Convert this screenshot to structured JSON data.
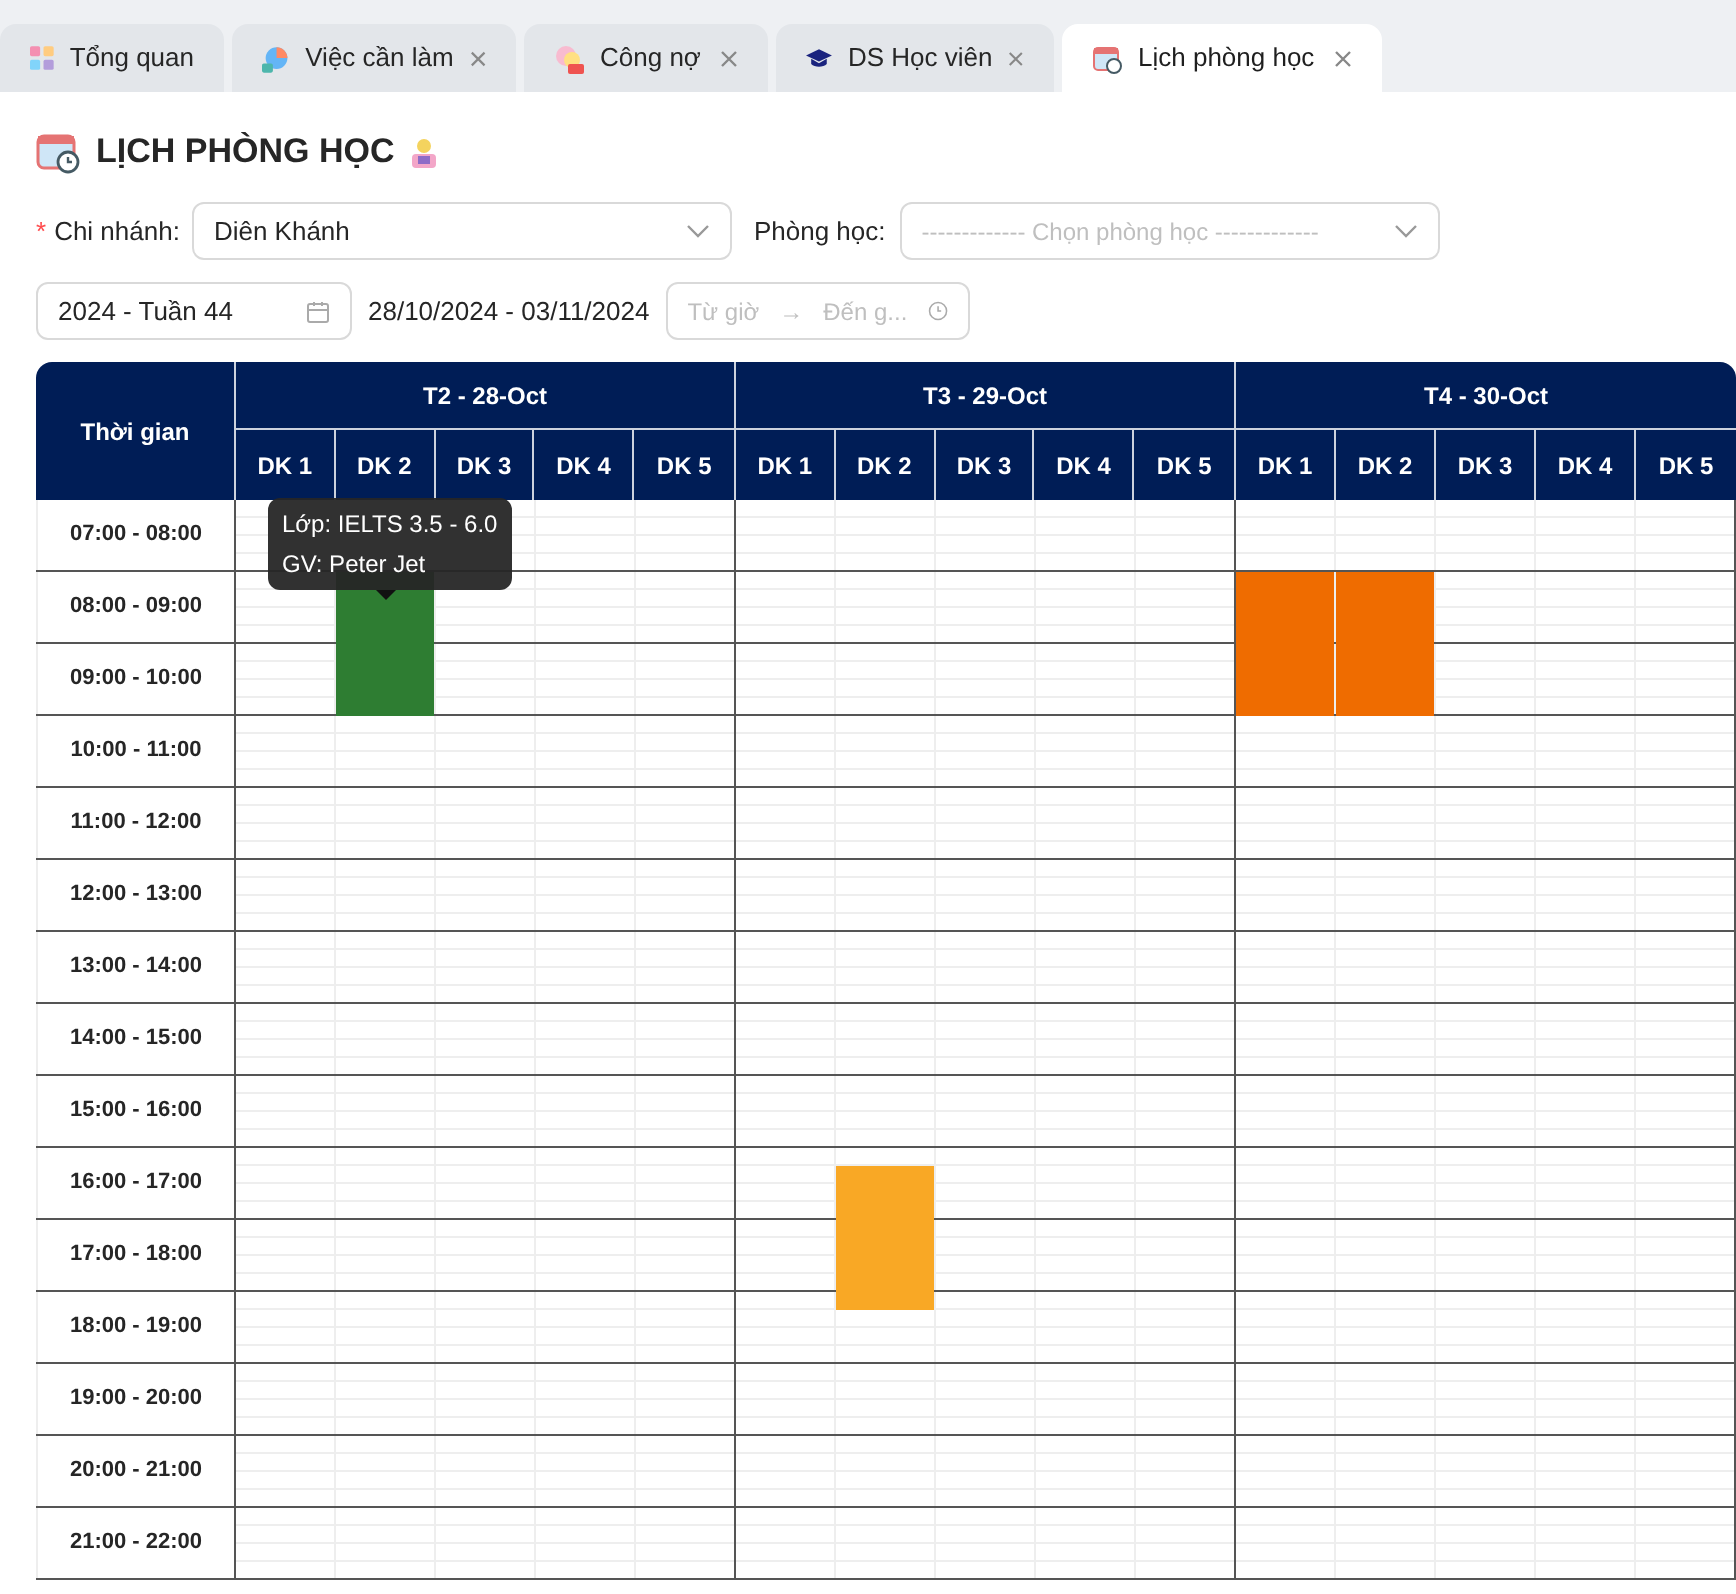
{
  "tabs": [
    {
      "label": "Tổng quan",
      "closable": false,
      "selected": false
    },
    {
      "label": "Việc cần làm",
      "closable": true,
      "selected": false
    },
    {
      "label": "Công nợ",
      "closable": true,
      "selected": false
    },
    {
      "label": "DS Học viên",
      "closable": true,
      "selected": false
    },
    {
      "label": "Lịch phòng học",
      "closable": true,
      "selected": true
    }
  ],
  "page": {
    "title": "LỊCH PHÒNG HỌC"
  },
  "filters": {
    "branch": {
      "required_mark": "*",
      "label": "Chi nhánh:",
      "value": "Diên Khánh"
    },
    "room": {
      "label": "Phòng học:",
      "placeholder": "------------- Chọn phòng học -------------"
    },
    "week": {
      "value": "2024 - Tuần 44"
    },
    "date_range": "28/10/2024 - 03/11/2024",
    "time_range": {
      "from_placeholder": "Từ giờ",
      "separator": "→",
      "to_placeholder": "Đến g..."
    }
  },
  "schedule": {
    "time_header": "Thời gian",
    "days": [
      {
        "label": "T2 - 28-Oct",
        "rooms": [
          "DK 1",
          "DK 2",
          "DK 3",
          "DK 4",
          "DK 5"
        ]
      },
      {
        "label": "T3 - 29-Oct",
        "rooms": [
          "DK 1",
          "DK 2",
          "DK 3",
          "DK 4",
          "DK 5"
        ]
      },
      {
        "label": "T4 - 30-Oct",
        "rooms": [
          "DK 1",
          "DK 2",
          "DK 3",
          "DK 4",
          "DK 5"
        ]
      }
    ],
    "rows": [
      "07:00 - 08:00",
      "08:00 - 09:00",
      "09:00 - 10:00",
      "10:00 - 11:00",
      "11:00 - 12:00",
      "12:00 - 13:00",
      "13:00 - 14:00",
      "14:00 - 15:00",
      "15:00 - 16:00",
      "16:00 - 17:00",
      "17:00 - 18:00",
      "18:00 - 19:00",
      "19:00 - 20:00",
      "20:00 - 21:00",
      "21:00 - 22:00"
    ],
    "events": [
      {
        "color": "#2e7d32",
        "tooltip": [
          "Lớp: IELTS 3.5 - 6.0",
          "GV: Peter Jet"
        ]
      },
      {
        "color": "#ef6c00"
      },
      {
        "color": "#ef6c00"
      },
      {
        "color": "#f9a825"
      }
    ]
  }
}
